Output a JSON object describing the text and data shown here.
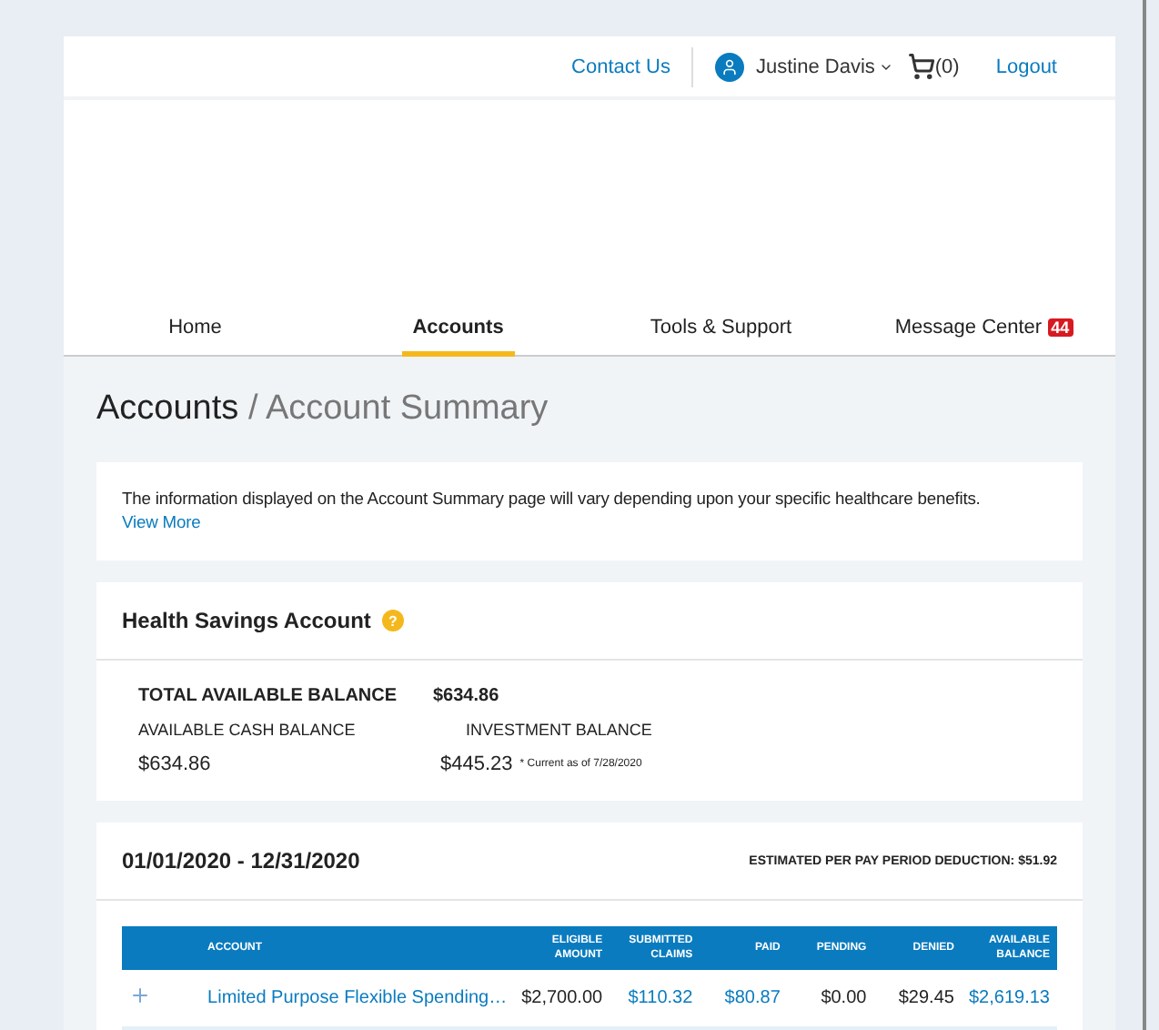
{
  "header": {
    "contact": "Contact Us",
    "user": "Justine Davis",
    "cart": "(0)",
    "logout": "Logout"
  },
  "nav": [
    {
      "label": "Home",
      "selected": false
    },
    {
      "label": "Accounts",
      "selected": true
    },
    {
      "label": "Tools & Support",
      "selected": false
    },
    {
      "label": "Message Center",
      "selected": false,
      "badge": "44"
    }
  ],
  "breadcrumb": {
    "current": "Accounts",
    "page": "/ Account Summary"
  },
  "notice": {
    "text": "The information displayed on the Account Summary page will vary depending upon your specific healthcare benefits.",
    "link": "View More"
  },
  "hsa": {
    "title": "Health Savings Account",
    "help": "?",
    "total_label": "TOTAL AVAILABLE BALANCE",
    "total_value": "$634.86",
    "cash_label": "AVAILABLE CASH BALANCE",
    "cash_value": "$634.86",
    "invest_label": "INVESTMENT BALANCE",
    "invest_value": "$445.23",
    "invest_note": "* Current as of 7/28/2020"
  },
  "plan": {
    "period": "01/01/2020 - 12/31/2020",
    "deduction": "ESTIMATED PER PAY PERIOD DEDUCTION: $51.92",
    "columns": [
      "ACCOUNT",
      "ELIGIBLE AMOUNT",
      "SUBMITTED CLAIMS",
      "PAID",
      "PENDING",
      "DENIED",
      "AVAILABLE BALANCE"
    ],
    "rows": [
      {
        "expanded": false,
        "cells": [
          {
            "text": "Limited Purpose Flexible Spending…",
            "link": true
          },
          {
            "text": "$2,700.00",
            "link": false
          },
          {
            "text": "$110.32",
            "link": true
          },
          {
            "text": "$80.87",
            "link": true
          },
          {
            "text": "$0.00",
            "link": false
          },
          {
            "text": "$29.45",
            "link": false
          },
          {
            "text": "$2,619.13",
            "link": true
          }
        ]
      }
    ]
  }
}
